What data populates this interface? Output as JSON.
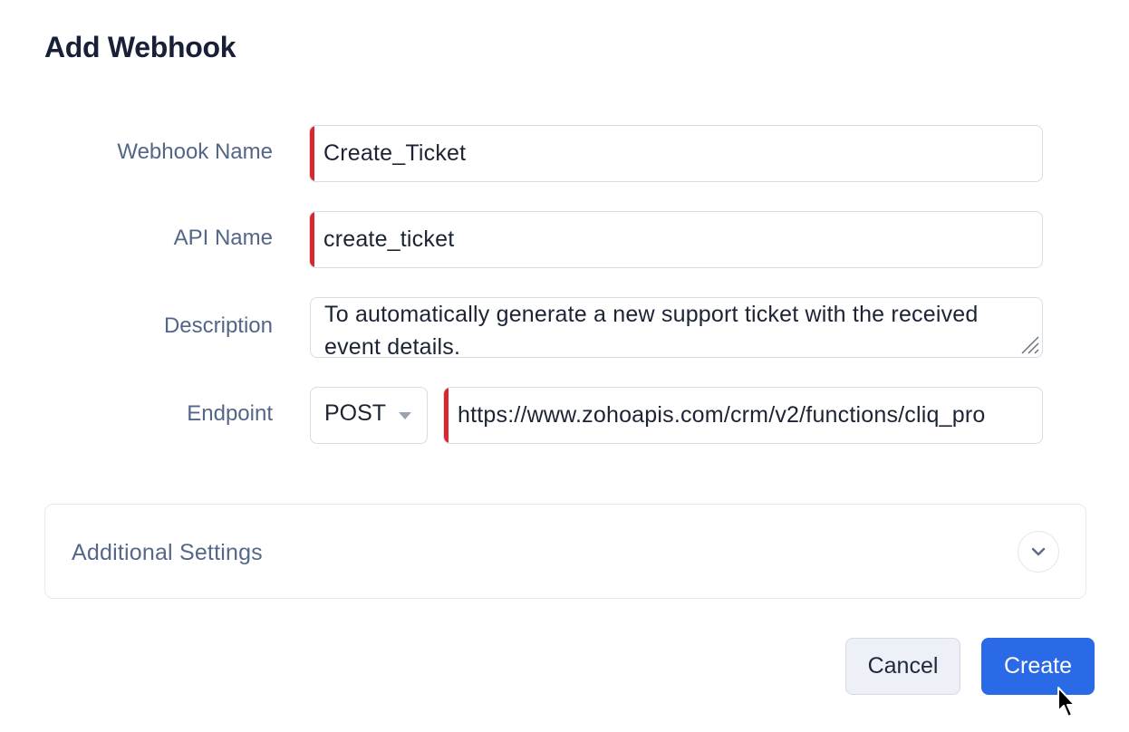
{
  "dialog": {
    "title": "Add Webhook"
  },
  "form": {
    "webhook_name": {
      "label": "Webhook Name",
      "value": "Create_Ticket"
    },
    "api_name": {
      "label": "API Name",
      "value": "create_ticket"
    },
    "description": {
      "label": "Description",
      "value": "To automatically generate a new support ticket with the received event details."
    },
    "endpoint": {
      "label": "Endpoint",
      "method": "POST",
      "url": "https://www.zohoapis.com/crm/v2/functions/cliq_pro"
    }
  },
  "additional_settings": {
    "label": "Additional Settings"
  },
  "actions": {
    "cancel_label": "Cancel",
    "create_label": "Create"
  },
  "colors": {
    "required_marker": "#d9262f",
    "primary": "#2a6ae6",
    "label": "#536687"
  }
}
